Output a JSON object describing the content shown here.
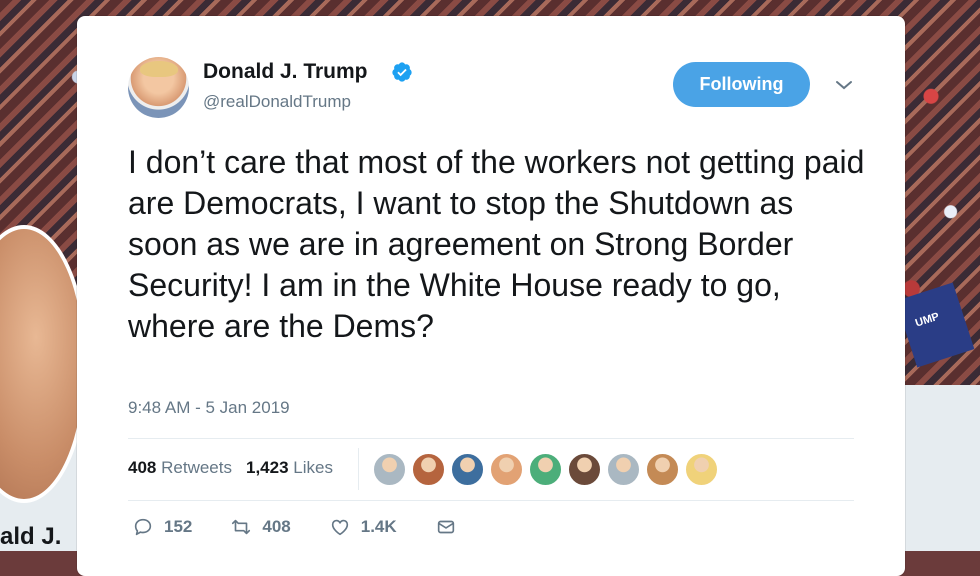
{
  "background": {
    "profile_name_fragment": "ald J.",
    "sign_text": "UMP"
  },
  "tweet": {
    "display_name": "Donald J. Trump",
    "handle": "@realDonaldTrump",
    "follow_label": "Following",
    "text": "I don’t care that most of the workers not getting paid are Democrats, I want to stop the Shutdown as soon as we are in agreement on Strong Border Security! I am in the White House ready to go, where are the Dems?",
    "timestamp": "9:48 AM - 5 Jan 2019",
    "retweet_count": "408",
    "retweets_label": "Retweets",
    "like_count": "1,423",
    "likes_label": "Likes",
    "liker_colors": [
      "#aab8c2",
      "#b5643e",
      "#3d6e9e",
      "#e2a274",
      "#4cae7a",
      "#6b4a3a",
      "#aab8c2",
      "#c48a55",
      "#f0d27a"
    ],
    "actions": {
      "reply_count": "152",
      "retweet_count": "408",
      "like_count": "1.4K"
    }
  },
  "colors": {
    "accent": "#4aa3e6",
    "verified": "#1da1f2",
    "muted_text": "#657786"
  }
}
